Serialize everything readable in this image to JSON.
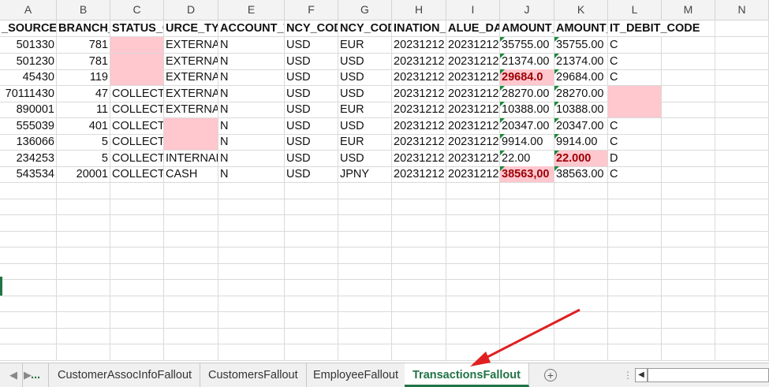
{
  "columns": [
    "A",
    "B",
    "C",
    "D",
    "E",
    "F",
    "G",
    "H",
    "I",
    "J",
    "K",
    "L",
    "M",
    "N"
  ],
  "header_row": [
    "_SOURCE_I",
    "BRANCH_ID",
    "STATUS_C",
    "URCE_TYP",
    "ACCOUNT_TR",
    "NCY_CODE",
    "NCY_CODE",
    "INATION_",
    "ALUE_DAT",
    "AMOUNT_",
    "AMOUNT_",
    "IT_DEBIT_CODE",
    "",
    ""
  ],
  "rows": [
    [
      "501330",
      "781",
      "",
      "EXTERNAL",
      "N",
      "USD",
      "EUR",
      "20231212",
      "20231212",
      "35755.00",
      "35755.00",
      "C",
      "",
      ""
    ],
    [
      "501230",
      "781",
      "",
      "EXTERNAL",
      "N",
      "USD",
      "USD",
      "20231212",
      "20231212",
      "21374.00",
      "21374.00",
      "C",
      "",
      ""
    ],
    [
      "45430",
      "119",
      "",
      "EXTERNAL",
      "N",
      "USD",
      "USD",
      "20231212",
      "20231212",
      "29684.0",
      "29684.00",
      "C",
      "",
      ""
    ],
    [
      "70111430",
      "47",
      "COLLECTE",
      "EXTERNAL",
      "N",
      "USD",
      "USD",
      "20231212",
      "20231212",
      "28270.00",
      "28270.00",
      "",
      "",
      ""
    ],
    [
      "890001",
      "11",
      "COLLECTE",
      "EXTERNAL",
      "N",
      "USD",
      "EUR",
      "20231212",
      "20231212",
      "10388.00",
      "10388.00",
      "",
      "",
      ""
    ],
    [
      "555039",
      "401",
      "COLLECTED",
      "",
      "N",
      "USD",
      "USD",
      "20231212",
      "20231212",
      "20347.00",
      "20347.00",
      "C",
      "",
      ""
    ],
    [
      "136066",
      "5",
      "COLLECTED",
      "",
      "N",
      "USD",
      "EUR",
      "20231212",
      "20231212",
      "9914.00",
      "9914.00",
      "C",
      "",
      ""
    ],
    [
      "234253",
      "5",
      "COLLECTE",
      "INTERNAL",
      "N",
      "USD",
      "USD",
      "20231212",
      "20231212",
      "22.00",
      "22.000",
      "D",
      "",
      ""
    ],
    [
      "543534",
      "20001",
      "COLLECTE",
      "CASH",
      "N",
      "USD",
      "JPNY",
      "20231212",
      "20231212",
      "38563,00",
      "38563.00",
      "C",
      "",
      ""
    ]
  ],
  "tabs": {
    "more": "...",
    "items": [
      "CustomerAssocInfoFallout",
      "CustomersFallout",
      "EmployeeFallout",
      "TransactionsFallout"
    ],
    "active": "TransactionsFallout",
    "add": "+"
  },
  "colors": {
    "accent": "#217346",
    "highlight_fill": "#ffc7ce",
    "highlight_text": "#9c0006",
    "arrow": "#e02020"
  }
}
